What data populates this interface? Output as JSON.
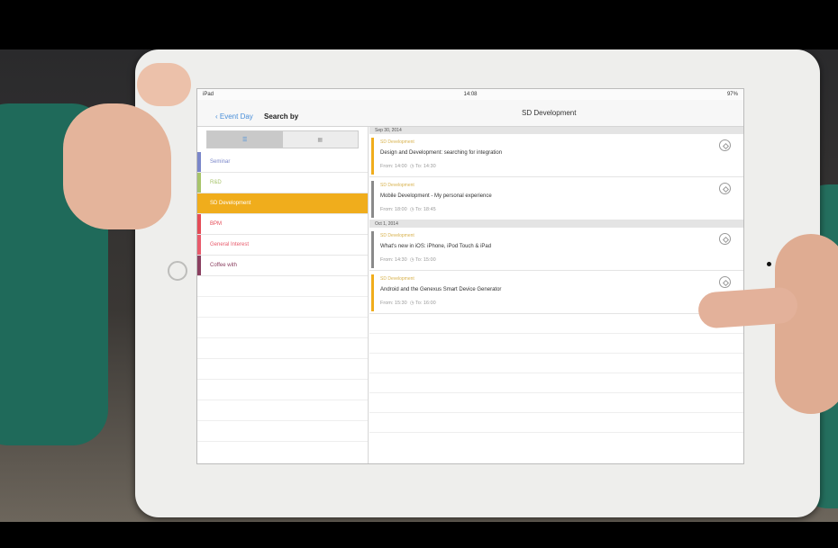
{
  "status": {
    "carrier": "iPad",
    "time": "14:08",
    "battery": "97%"
  },
  "navbar": {
    "back_label": "Event Day",
    "search_label": "Search by",
    "title": "SD Development"
  },
  "segments": [
    {
      "label": ""
    },
    {
      "label": ""
    }
  ],
  "categories": [
    {
      "label": "Seminar",
      "color": "#7a86c9"
    },
    {
      "label": "R&D",
      "color": "#a7c46a"
    },
    {
      "label": "SD Development",
      "color": "#f0ad1c",
      "selected": true
    },
    {
      "label": "BPM",
      "color": "#e44b56"
    },
    {
      "label": "General Interest",
      "color": "#e85a6b"
    },
    {
      "label": "Coffee with",
      "color": "#8a3f60"
    }
  ],
  "days": [
    {
      "date": "Sep 30, 2014",
      "events": [
        {
          "category": "SD Development",
          "title": "Design and Development: searching for integration",
          "from": "14:00",
          "to": "14:30",
          "stripe": "#f0ad1c"
        },
        {
          "category": "SD Development",
          "title": "Mobile Development - My personal experience",
          "from": "18:00",
          "to": "18:45",
          "stripe": "#8a8a8a"
        }
      ]
    },
    {
      "date": "Oct 1, 2014",
      "events": [
        {
          "category": "SD Development",
          "title": "What's new in iOS: iPhone, iPod Touch & iPad",
          "from": "14:30",
          "to": "15:00",
          "stripe": "#8a8a8a"
        },
        {
          "category": "SD Development",
          "title": "Android and the Genexus Smart Device Generator",
          "from": "15:30",
          "to": "16:00",
          "stripe": "#f0ad1c"
        }
      ]
    }
  ],
  "labels": {
    "from": "From",
    "to": "To"
  }
}
